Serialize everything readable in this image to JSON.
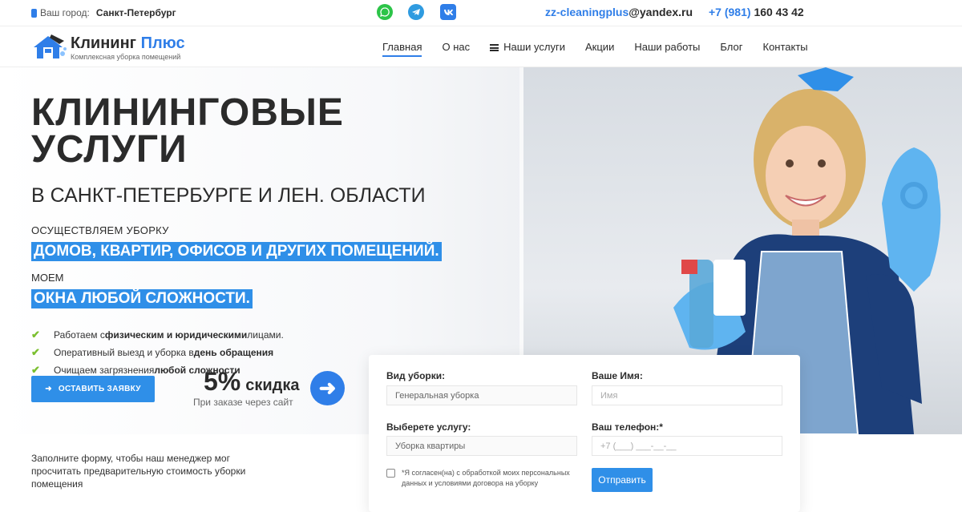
{
  "topbar": {
    "city_label": "Ваш город:",
    "city_value": "Санкт-Петербург",
    "social": [
      "whatsapp-icon",
      "telegram-icon",
      "vk-icon"
    ],
    "email_user": "zz-cleaningplus",
    "email_domain": "@yandex.ru",
    "phone_code": "+7 (981)",
    "phone_number": "160 43 42"
  },
  "logo": {
    "title_a": "Клининг",
    "title_b": "Плюс",
    "subtitle": "Комплексная уборка помещений"
  },
  "nav": {
    "items": [
      "Главная",
      "О нас",
      "Наши услуги",
      "Акции",
      "Наши работы",
      "Блог",
      "Контакты"
    ],
    "active": "Главная"
  },
  "hero": {
    "title_line1": "КЛИНИНГОВЫЕ",
    "title_line2": "УСЛУГИ",
    "subtitle": "В САНКТ-ПЕТЕРБУРГЕ И ЛЕН. ОБЛАСТИ",
    "text1": "ОСУЩЕСТВЛЯЕМ УБОРКУ",
    "highlight1": "ДОМОВ, КВАРТИР, ОФИСОВ И ДРУГИХ ПОМЕЩЕНИЙ.",
    "text2": "МОЕМ",
    "highlight2": "ОКНА ЛЮБОЙ СЛОЖНОСТИ.",
    "checks": [
      {
        "pre": "Работаем  с ",
        "bold": "физическим и юридическими",
        "post": " лицами."
      },
      {
        "pre": "Оперативный выезд и уборка в ",
        "bold": "день обращения",
        "post": ""
      },
      {
        "pre": "Очищаем загрязнения ",
        "bold": "любой сложности",
        "post": ""
      }
    ],
    "cta_label": "ОСТАВИТЬ ЗАЯВКУ",
    "discount_big": "5%",
    "discount_small": "скидка",
    "discount_note": "При заказе через сайт",
    "note": "Заполните форму, чтобы наш менеджер мог просчитать предварительную стоимость уборки помещения"
  },
  "form": {
    "type_label": "Вид уборки:",
    "type_value": "Генеральная уборка",
    "name_label": "Ваше Имя:",
    "name_placeholder": "Имя",
    "service_label": "Выберете услугу:",
    "service_value": "Уборка квартиры",
    "phone_label": "Ваш телефон:*",
    "phone_placeholder": "+7 (___) ___-__-__",
    "agree_text": "*Я согласен(на) с обработкой моих персональных данных и условиями договора на уборку",
    "submit_label": "Отправить"
  },
  "colors": {
    "accent": "#2f7ee8",
    "highlight": "#2f8fe8",
    "check": "#7bbf2f"
  }
}
